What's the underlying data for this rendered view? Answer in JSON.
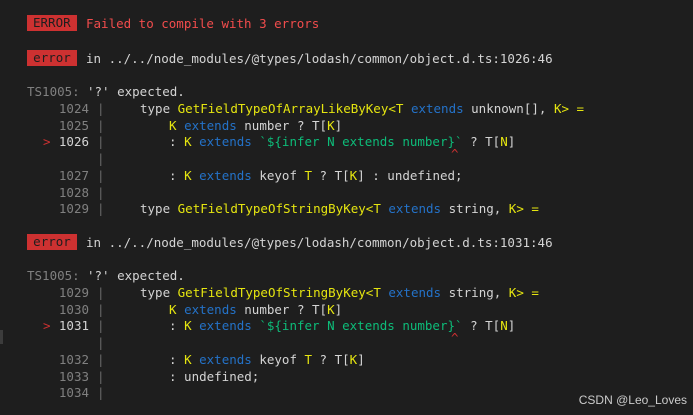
{
  "header": {
    "badge": "ERROR",
    "message": "Failed to compile with 3 errors"
  },
  "blocks": [
    {
      "badge": "error",
      "location": "in ../../node_modules/@types/lodash/common/object.d.ts:1026:46",
      "ts_code": "TS1005:",
      "ts_message": "'?' expected.",
      "lines": [
        {
          "num": "1024",
          "marker": "",
          "parts": [
            [
              "k",
              "type "
            ],
            [
              "t",
              "GetFieldTypeOfArrayLikeByKey"
            ],
            [
              "t",
              "<T "
            ],
            [
              "b",
              "extends"
            ],
            [
              "k",
              " unknown[], "
            ],
            [
              "t",
              "K"
            ],
            [
              "t",
              "> ="
            ]
          ]
        },
        {
          "num": "1025",
          "marker": "",
          "parts": [
            [
              "t",
              "K "
            ],
            [
              "b",
              "extends"
            ],
            [
              "k",
              " number ? "
            ],
            [
              "k",
              "T["
            ],
            [
              "t",
              "K"
            ],
            [
              "k",
              "]"
            ]
          ]
        },
        {
          "num": "1026",
          "marker": ">",
          "parts": [
            [
              "k",
              ": "
            ],
            [
              "t",
              "K "
            ],
            [
              "b",
              "extends"
            ],
            [
              "k",
              " "
            ],
            [
              "g",
              "`${infer N extends number}`"
            ],
            [
              "k",
              " ? T["
            ],
            [
              "t",
              "N"
            ],
            [
              "k",
              "]"
            ]
          ]
        },
        {
          "num": "",
          "marker": "",
          "caret": "^",
          "parts": []
        },
        {
          "num": "1027",
          "marker": "",
          "parts": [
            [
              "k",
              ": "
            ],
            [
              "t",
              "K "
            ],
            [
              "b",
              "extends"
            ],
            [
              "k",
              " keyof "
            ],
            [
              "t",
              "T"
            ],
            [
              "k",
              " ? T["
            ],
            [
              "t",
              "K"
            ],
            [
              "k",
              "] : undefined;"
            ]
          ]
        },
        {
          "num": "1028",
          "marker": "",
          "parts": []
        },
        {
          "num": "1029",
          "marker": "",
          "parts": [
            [
              "k",
              "type "
            ],
            [
              "t",
              "GetFieldTypeOfStringByKey"
            ],
            [
              "t",
              "<T "
            ],
            [
              "b",
              "extends"
            ],
            [
              "k",
              " string, "
            ],
            [
              "t",
              "K"
            ],
            [
              "t",
              "> ="
            ]
          ]
        }
      ]
    },
    {
      "badge": "error",
      "location": "in ../../node_modules/@types/lodash/common/object.d.ts:1031:46",
      "ts_code": "TS1005:",
      "ts_message": "'?' expected.",
      "lines": [
        {
          "num": "1029",
          "marker": "",
          "parts": [
            [
              "k",
              "type "
            ],
            [
              "t",
              "GetFieldTypeOfStringByKey"
            ],
            [
              "t",
              "<T "
            ],
            [
              "b",
              "extends"
            ],
            [
              "k",
              " string, "
            ],
            [
              "t",
              "K"
            ],
            [
              "t",
              "> ="
            ]
          ]
        },
        {
          "num": "1030",
          "marker": "",
          "parts": [
            [
              "t",
              "K "
            ],
            [
              "b",
              "extends"
            ],
            [
              "k",
              " number ? "
            ],
            [
              "k",
              "T["
            ],
            [
              "t",
              "K"
            ],
            [
              "k",
              "]"
            ]
          ]
        },
        {
          "num": "1031",
          "marker": ">",
          "parts": [
            [
              "k",
              ": "
            ],
            [
              "t",
              "K "
            ],
            [
              "b",
              "extends"
            ],
            [
              "k",
              " "
            ],
            [
              "g",
              "`${infer N extends number}`"
            ],
            [
              "k",
              " ? T["
            ],
            [
              "t",
              "N"
            ],
            [
              "k",
              "]"
            ]
          ]
        },
        {
          "num": "",
          "marker": "",
          "caret": "^",
          "parts": []
        },
        {
          "num": "1032",
          "marker": "",
          "parts": [
            [
              "k",
              ": "
            ],
            [
              "t",
              "K "
            ],
            [
              "b",
              "extends"
            ],
            [
              "k",
              " keyof "
            ],
            [
              "t",
              "T"
            ],
            [
              "k",
              " ? T["
            ],
            [
              "t",
              "K"
            ],
            [
              "k",
              "]"
            ]
          ]
        },
        {
          "num": "1033",
          "marker": "",
          "parts": [
            [
              "k",
              ": undefined;"
            ]
          ]
        },
        {
          "num": "1034",
          "marker": "",
          "parts": []
        }
      ]
    }
  ],
  "watermark": "CSDN @Leo_Loves",
  "colors": {
    "background": "#1e1e1e",
    "error_red": "#f14c4c",
    "badge_red": "#cd3131",
    "type_yellow": "#e5e510",
    "keyword_blue": "#2472c8",
    "string_green": "#0dbc79"
  }
}
